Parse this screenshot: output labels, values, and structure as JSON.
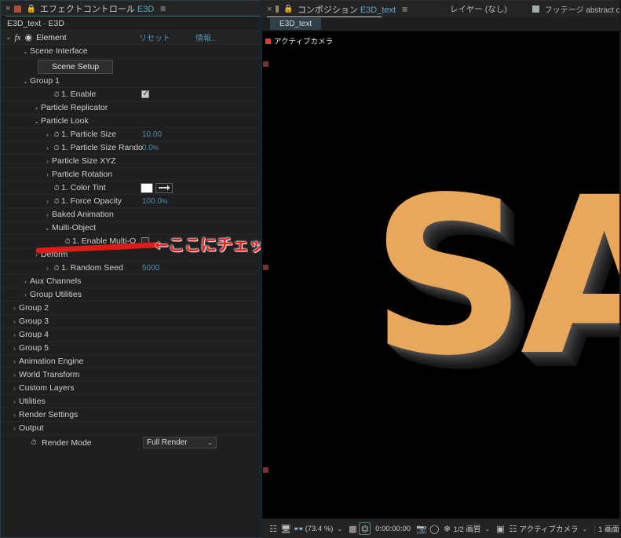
{
  "effect_controls": {
    "tab": {
      "close_icon": "×",
      "title": "エフェクトコントロール",
      "title_accent": "E3D",
      "menu_icon": "≡",
      "lock_icon": "🔒"
    },
    "breadcrumb": "E3D_text · E3D",
    "effect_row": {
      "twisty": "⌄",
      "fx": "fx",
      "name": "Element",
      "reset": "リセット",
      "about": "情報.."
    },
    "scene_setup_button": "Scene Setup",
    "tree": [
      {
        "indent": 1,
        "twisty": "⌄",
        "label": "Scene Interface"
      },
      {
        "indent": 1,
        "twisty": "⌄",
        "label": "Group 1"
      },
      {
        "indent": 3,
        "twisty": "",
        "stopwatch": true,
        "label": "1. Enable",
        "checkbox": "checked"
      },
      {
        "indent": 2,
        "twisty": "›",
        "label": "Particle Replicator"
      },
      {
        "indent": 2,
        "twisty": "⌄",
        "label": "Particle Look"
      },
      {
        "indent": 3,
        "twisty": "›",
        "stopwatch": true,
        "label": "1. Particle Size",
        "value": "10.00"
      },
      {
        "indent": 3,
        "twisty": "›",
        "stopwatch": true,
        "label": "1. Particle Size Rando",
        "value": "0.0",
        "unit": "%"
      },
      {
        "indent": 3,
        "twisty": "›",
        "label": "Particle Size XYZ"
      },
      {
        "indent": 3,
        "twisty": "›",
        "label": "Particle Rotation"
      },
      {
        "indent": 3,
        "twisty": "",
        "stopwatch": true,
        "label": "1. Color Tint",
        "swatch": "#ffffff"
      },
      {
        "indent": 3,
        "twisty": "›",
        "stopwatch": true,
        "label": "1. Force Opacity",
        "value": "100.0",
        "unit": "%"
      },
      {
        "indent": 3,
        "twisty": "›",
        "label": "Baked Animation"
      },
      {
        "indent": 3,
        "twisty": "⌄",
        "label": "Multi-Object"
      },
      {
        "indent": 4,
        "twisty": "",
        "stopwatch": true,
        "label": "1. Enable Multi-O",
        "checkbox": "empty"
      },
      {
        "indent": 2,
        "twisty": "›",
        "label": "Deform"
      },
      {
        "indent": 3,
        "twisty": "›",
        "stopwatch": true,
        "label": "1. Random Seed",
        "value": "5000"
      },
      {
        "indent": 1,
        "twisty": "›",
        "label": "Aux Channels"
      },
      {
        "indent": 1,
        "twisty": "›",
        "label": "Group Utilities"
      },
      {
        "indent": 0,
        "twisty": "›",
        "label": "Group 2"
      },
      {
        "indent": 0,
        "twisty": "›",
        "label": "Group 3"
      },
      {
        "indent": 0,
        "twisty": "›",
        "label": "Group 4"
      },
      {
        "indent": 0,
        "twisty": "›",
        "label": "Group 5"
      },
      {
        "indent": 0,
        "twisty": "›",
        "label": "Animation Engine"
      },
      {
        "indent": 0,
        "twisty": "›",
        "label": "World Transform"
      },
      {
        "indent": 0,
        "twisty": "›",
        "label": "Custom Layers"
      },
      {
        "indent": 0,
        "twisty": "›",
        "label": "Utilities"
      },
      {
        "indent": 0,
        "twisty": "›",
        "label": "Render Settings"
      },
      {
        "indent": 0,
        "twisty": "›",
        "label": "Output"
      }
    ],
    "render_mode": {
      "label": "Render Mode",
      "value": "Full Render",
      "chevron": "⌄"
    }
  },
  "annotation": {
    "text": "←ここにチェックを入れる",
    "color": "#e8201c"
  },
  "composition": {
    "tab": {
      "close_icon": "×",
      "title": "コンポジション",
      "comp_name": "E3D_text",
      "menu_icon": "≡"
    },
    "layer_tab": "レイヤー (なし)",
    "footage_tab": "フッテージ abstract colorful powder flowing throu",
    "sub_tab": "E3D_text",
    "camera_label": "アクティブカメラ",
    "viewport_text": "SA",
    "viewport_text_color": "#e8a75b",
    "bottom_bar": {
      "zoom": "(73.4 %)",
      "zoom_chevron": "⌄",
      "timecode": "0:00:00:00",
      "resolution": "1/2 画質",
      "resolution_chevron": "⌄",
      "camera_view": "アクティブカメラ",
      "camera_chevron": "⌄",
      "view_count": "1 画面"
    }
  }
}
